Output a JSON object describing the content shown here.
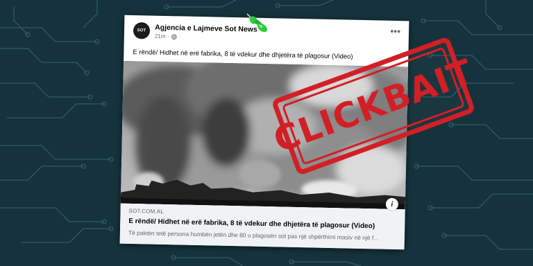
{
  "post": {
    "page_name": "Agjencia e Lajmeve Sot News",
    "time_ago": "21m",
    "time_separator": "·",
    "avatar_text": "SOT",
    "more_icon": "more-horizontal-icon",
    "caption": "E rëndë/ Hidhet në erë fabrika, 8 të vdekur dhe dhjetëra të plagosur (Video)"
  },
  "link_preview": {
    "domain": "SOT.COM.AL",
    "title": "E rëndë/ Hidhet në erë fabrika, 8 të vdekur dhe dhjetëra të plagosur (Video)",
    "description": "Të paktën tetë persona humbën jetën dhe 80 u plagosën sot pas një shpërthimi masiv në një f...",
    "info_label": "i"
  },
  "stamp": {
    "text": "CLICKBAIT",
    "color": "#d21f26"
  },
  "colors": {
    "background": "#16333d",
    "circuit": "#2f5b66",
    "pushpin": "#2ecc40"
  }
}
